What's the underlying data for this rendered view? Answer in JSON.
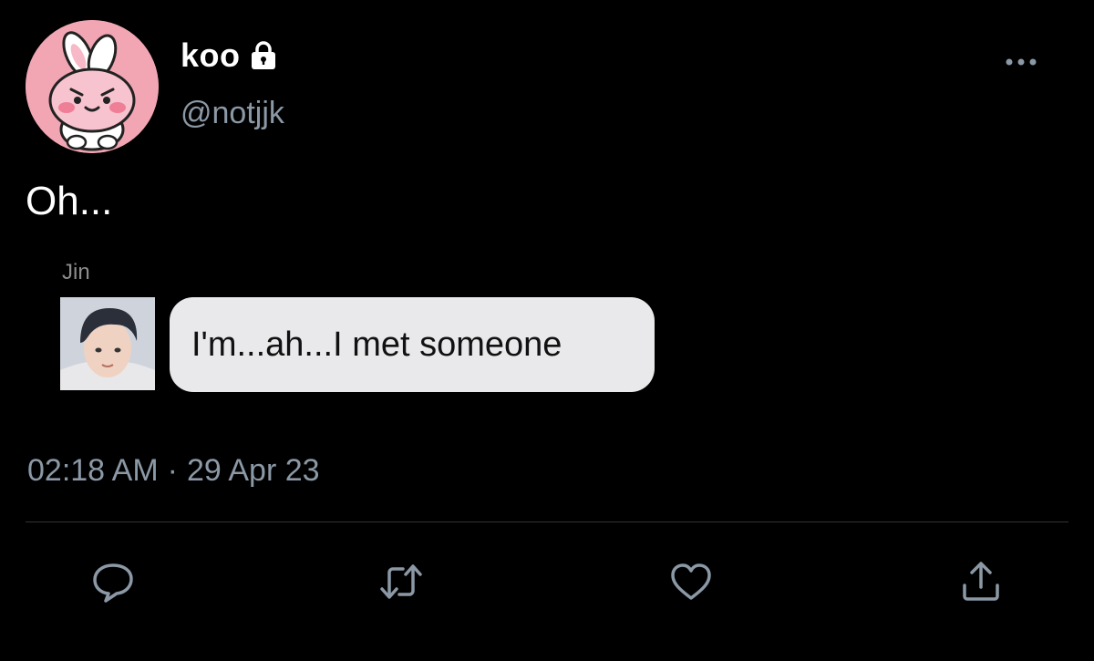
{
  "tweet": {
    "author": {
      "display_name": "koo",
      "handle": "@notjjk",
      "protected_icon": "lock-icon",
      "avatar_icon": "bunny-avatar"
    },
    "text": "Oh...",
    "quoted_message": {
      "sender": "Jin",
      "message": "I'm...ah...I met someone"
    },
    "time": "02:18 AM",
    "separator": "·",
    "date": "29 Apr 23",
    "actions": [
      "reply-icon",
      "retweet-icon",
      "like-icon",
      "share-icon"
    ],
    "menu_icon": "more-icon"
  },
  "colors": {
    "background": "#000000",
    "primary_text": "#ffffff",
    "secondary_text": "#8b98a5",
    "divider": "#2f3336",
    "bubble": "#e9e9eb",
    "avatar_bg": "#f2a6b3"
  }
}
